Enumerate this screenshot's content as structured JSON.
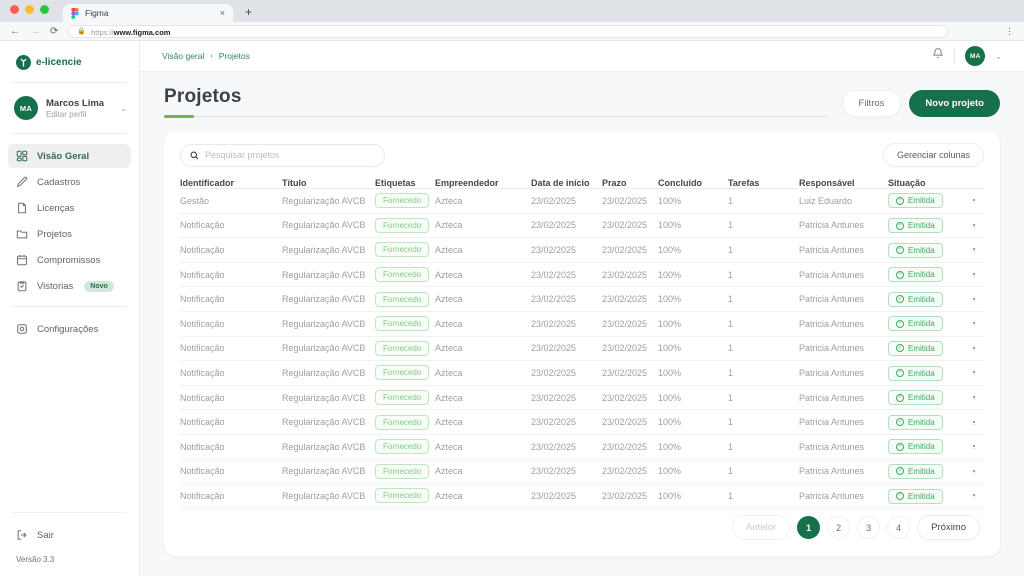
{
  "browser": {
    "tab_title": "Figma",
    "tab_close": "×",
    "new_tab": "+",
    "back": "←",
    "forward": "→",
    "refresh": "⟳",
    "url_protocol": "https://",
    "url_domain": "www.figma.com",
    "menu": "⋮"
  },
  "sidebar": {
    "logo_text": "e-licencie",
    "profile": {
      "initials": "MA",
      "name": "Marcos Lima",
      "subtitle": "Editar perfil",
      "chevron": "⌄"
    },
    "items": [
      {
        "label": "Visão Geral"
      },
      {
        "label": "Cadastros"
      },
      {
        "label": "Licenças"
      },
      {
        "label": "Projetos"
      },
      {
        "label": "Compromissos"
      },
      {
        "label": "Vistorias",
        "badge": "Novo"
      },
      {
        "label": "Configurações"
      }
    ],
    "sair_label": "Sair",
    "version": "Versão 3.3"
  },
  "topbar": {
    "breadcrumb": {
      "parent": "Visão geral",
      "separator": "›",
      "current": "Projetos"
    },
    "avatar_initials": "MA",
    "chevron": "⌄"
  },
  "page": {
    "title": "Projetos",
    "filters_label": "Filtros",
    "new_project_label": "Novo projeto"
  },
  "table": {
    "search_placeholder": "Pesquisar projetos",
    "manage_columns_label": "Gerenciar colunas",
    "columns": [
      "Identificador",
      "Título",
      "Etiquetas",
      "Empreendedor",
      "Data de início",
      "Prazo",
      "Concluído",
      "Tarefas",
      "Responsável",
      "Situação"
    ],
    "status_check": "✓",
    "kebab": "⋮",
    "rows": [
      {
        "identificador": "Gestão",
        "titulo": "Regularização AVCB",
        "etiqueta": "Fornecedo",
        "empreendedor": "Azteca",
        "inicio": "23/02/2025",
        "prazo": "23/02/2025",
        "concluido": "100%",
        "tarefas": "1",
        "responsavel": "Luiz Eduardo",
        "situacao": "Emitida"
      },
      {
        "identificador": "Notificação",
        "titulo": "Regularização AVCB",
        "etiqueta": "Fornecedo",
        "empreendedor": "Azteca",
        "inicio": "23/02/2025",
        "prazo": "23/02/2025",
        "concluido": "100%",
        "tarefas": "1",
        "responsavel": "Patricia Antunes",
        "situacao": "Emitida"
      },
      {
        "identificador": "Notificação",
        "titulo": "Regularização AVCB",
        "etiqueta": "Fornecedo",
        "empreendedor": "Azteca",
        "inicio": "23/02/2025",
        "prazo": "23/02/2025",
        "concluido": "100%",
        "tarefas": "1",
        "responsavel": "Patricia Antunes",
        "situacao": "Emitida"
      },
      {
        "identificador": "Notificação",
        "titulo": "Regularização AVCB",
        "etiqueta": "Fornecedo",
        "empreendedor": "Azteca",
        "inicio": "23/02/2025",
        "prazo": "23/02/2025",
        "concluido": "100%",
        "tarefas": "1",
        "responsavel": "Patricia Antunes",
        "situacao": "Emitida"
      },
      {
        "identificador": "Notificação",
        "titulo": "Regularização AVCB",
        "etiqueta": "Fornecedo",
        "empreendedor": "Azteca",
        "inicio": "23/02/2025",
        "prazo": "23/02/2025",
        "concluido": "100%",
        "tarefas": "1",
        "responsavel": "Patricia Antunes",
        "situacao": "Emitida"
      },
      {
        "identificador": "Notificação",
        "titulo": "Regularização AVCB",
        "etiqueta": "Fornecedo",
        "empreendedor": "Azteca",
        "inicio": "23/02/2025",
        "prazo": "23/02/2025",
        "concluido": "100%",
        "tarefas": "1",
        "responsavel": "Patricia Antunes",
        "situacao": "Emitida"
      },
      {
        "identificador": "Notificação",
        "titulo": "Regularização AVCB",
        "etiqueta": "Fornecedo",
        "empreendedor": "Azteca",
        "inicio": "23/02/2025",
        "prazo": "23/02/2025",
        "concluido": "100%",
        "tarefas": "1",
        "responsavel": "Patricia Antunes",
        "situacao": "Emitida"
      },
      {
        "identificador": "Notificação",
        "titulo": "Regularização AVCB",
        "etiqueta": "Fornecedo",
        "empreendedor": "Azteca",
        "inicio": "23/02/2025",
        "prazo": "23/02/2025",
        "concluido": "100%",
        "tarefas": "1",
        "responsavel": "Patricia Antunes",
        "situacao": "Emitida"
      },
      {
        "identificador": "Notificação",
        "titulo": "Regularização AVCB",
        "etiqueta": "Fornecedo",
        "empreendedor": "Azteca",
        "inicio": "23/02/2025",
        "prazo": "23/02/2025",
        "concluido": "100%",
        "tarefas": "1",
        "responsavel": "Patricia Antunes",
        "situacao": "Emitida"
      },
      {
        "identificador": "Notificação",
        "titulo": "Regularização AVCB",
        "etiqueta": "Fornecedo",
        "empreendedor": "Azteca",
        "inicio": "23/02/2025",
        "prazo": "23/02/2025",
        "concluido": "100%",
        "tarefas": "1",
        "responsavel": "Patricia Antunes",
        "situacao": "Emitida"
      },
      {
        "identificador": "Notificação",
        "titulo": "Regularização AVCB",
        "etiqueta": "Fornecedo",
        "empreendedor": "Azteca",
        "inicio": "23/02/2025",
        "prazo": "23/02/2025",
        "concluido": "100%",
        "tarefas": "1",
        "responsavel": "Patricia Antunes",
        "situacao": "Emitida"
      },
      {
        "identificador": "Notificação",
        "titulo": "Regularização AVCB",
        "etiqueta": "Fornecedo",
        "empreendedor": "Azteca",
        "inicio": "23/02/2025",
        "prazo": "23/02/2025",
        "concluido": "100%",
        "tarefas": "1",
        "responsavel": "Patricia Antunes",
        "situacao": "Emitida"
      },
      {
        "identificador": "Notificação",
        "titulo": "Regularização AVCB",
        "etiqueta": "Fornecedo",
        "empreendedor": "Azteca",
        "inicio": "23/02/2025",
        "prazo": "23/02/2025",
        "concluido": "100%",
        "tarefas": "1",
        "responsavel": "Patricia Antunes",
        "situacao": "Emitida"
      }
    ]
  },
  "pagination": {
    "prev_label": "Anteior",
    "next_label": "Próximo",
    "pages": [
      "1",
      "2",
      "3",
      "4"
    ],
    "active_page": "1"
  },
  "colors": {
    "accent_green": "#17704c",
    "breadcrumb_green": "#2e8464",
    "tag_green": "#83cb83",
    "status_green": "#44a75f",
    "underline_green": "#7fae52"
  }
}
